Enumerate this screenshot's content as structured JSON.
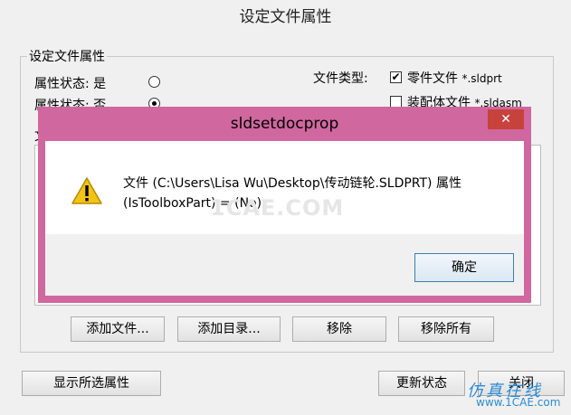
{
  "window": {
    "title": "设定文件属性"
  },
  "group": {
    "label": "设定文件属性",
    "prop_yes_label": "属性状态: 是",
    "prop_no_label": "属性状态: 否",
    "file_type_label": "文件类型:",
    "file_types": [
      {
        "label": "零件文件",
        "ext": "*.sldprt",
        "checked": true
      },
      {
        "label": "装配体文件",
        "ext": "*.sldasm",
        "checked": false
      }
    ],
    "list_label_char": "文"
  },
  "buttons": {
    "add_file": "添加文件...",
    "add_dir": "添加目录...",
    "remove": "移除",
    "remove_all": "移除所有",
    "show_selected": "显示所选属性",
    "refresh": "更新状态",
    "close": "关闭"
  },
  "dialog": {
    "title": "sldsetdocprop",
    "close_glyph": "✕",
    "message_line1": "文件 (C:\\Users\\Lisa Wu\\Desktop\\传动链轮.SLDPRT) 属性",
    "message_line2": "(IsToolboxPart) = (No)",
    "ok": "确定",
    "icon": "warning-icon"
  },
  "watermark": "1CAE.COM",
  "branding": {
    "line1": "仿真在线",
    "line2": "www.1CAE.com"
  },
  "colors": {
    "dialog_frame": "#d0679e",
    "close_button": "#c7423c",
    "warning": "#f3c316"
  }
}
